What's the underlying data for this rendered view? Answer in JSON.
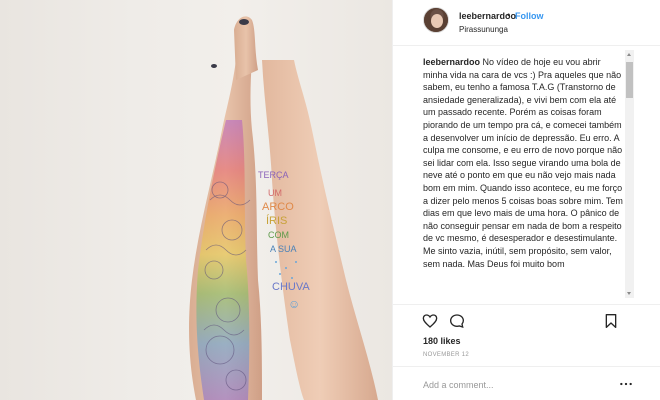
{
  "header": {
    "username": "leebernardoo",
    "separator": "•",
    "follow_label": "Follow",
    "location": "Pirassununga"
  },
  "caption": {
    "username": "leebernardoo",
    "text": "No vídeo de hoje eu vou abrir minha vida na cara de vcs :) Pra aqueles que não sabem, eu tenho a famosa T.A.G (Transtorno de ansiedade generalizada), e vivi bem com ela até um passado recente. Porém as coisas foram piorando de um tempo pra cá, e comecei também a desenvolver um início de depressão. Eu erro. A culpa me consome, e eu erro de novo porque não sei lidar com ela. Isso segue virando uma bola de neve até o ponto em que eu não vejo mais nada bom em mim. Quando isso acontece, eu me forço a dizer pelo menos 5 coisas boas sobre mim. Tem dias em que levo mais de uma hora. O pânico de não conseguir pensar em nada de bom a respeito de vc mesmo, é desesperador e desestimulante. Me sinto vazia, inútil, sem propósito, sem valor, sem nada. Mas Deus foi muito bom"
  },
  "photo": {
    "leg_text_lines": [
      "TERÇA",
      "UM",
      "ARCO",
      "ÍRIS",
      "COM",
      "A SUA",
      "CHUVA"
    ],
    "smiley": "☺"
  },
  "actions": {
    "like_icon": "heart-icon",
    "comment_icon": "comment-icon",
    "save_icon": "bookmark-icon"
  },
  "likes": "180 likes",
  "date": "NOVEMBER 12",
  "comment": {
    "placeholder": "Add a comment...",
    "more_icon": "more-options-icon"
  }
}
